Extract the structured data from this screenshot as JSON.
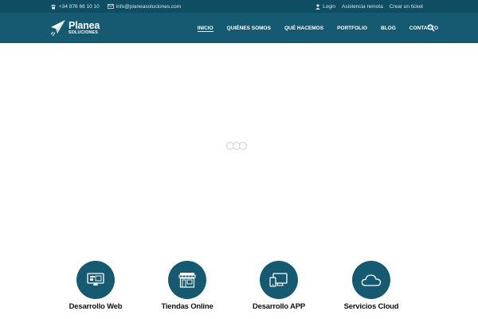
{
  "topbar": {
    "phone": "+34 876 66 10 10",
    "email": "info@planeasoluciones.com",
    "login": "Login",
    "remote": "Asistencia remota",
    "ticket": "Crear un ticket"
  },
  "logo": {
    "name": "Planea",
    "sub": "SOLUCIONES"
  },
  "nav": {
    "items": [
      {
        "label": "INICIO"
      },
      {
        "label": "QUIÉNES SOMOS"
      },
      {
        "label": "QUÉ HACEMOS"
      },
      {
        "label": "PORTFOLIO"
      },
      {
        "label": "BLOG"
      },
      {
        "label": "CONTACTO"
      }
    ],
    "active": "INICIO"
  },
  "services": [
    {
      "title": "Desarrollo Web",
      "icon": "monitor-web-icon"
    },
    {
      "title": "Tiendas Online",
      "icon": "store-icon"
    },
    {
      "title": "Desarrollo APP",
      "icon": "devices-icon"
    },
    {
      "title": "Servicios Cloud",
      "icon": "cloud-icon"
    }
  ],
  "colors": {
    "topbar": "#0f4d63",
    "header": "#155a70",
    "accent": "#155a70",
    "text": "#111111"
  }
}
